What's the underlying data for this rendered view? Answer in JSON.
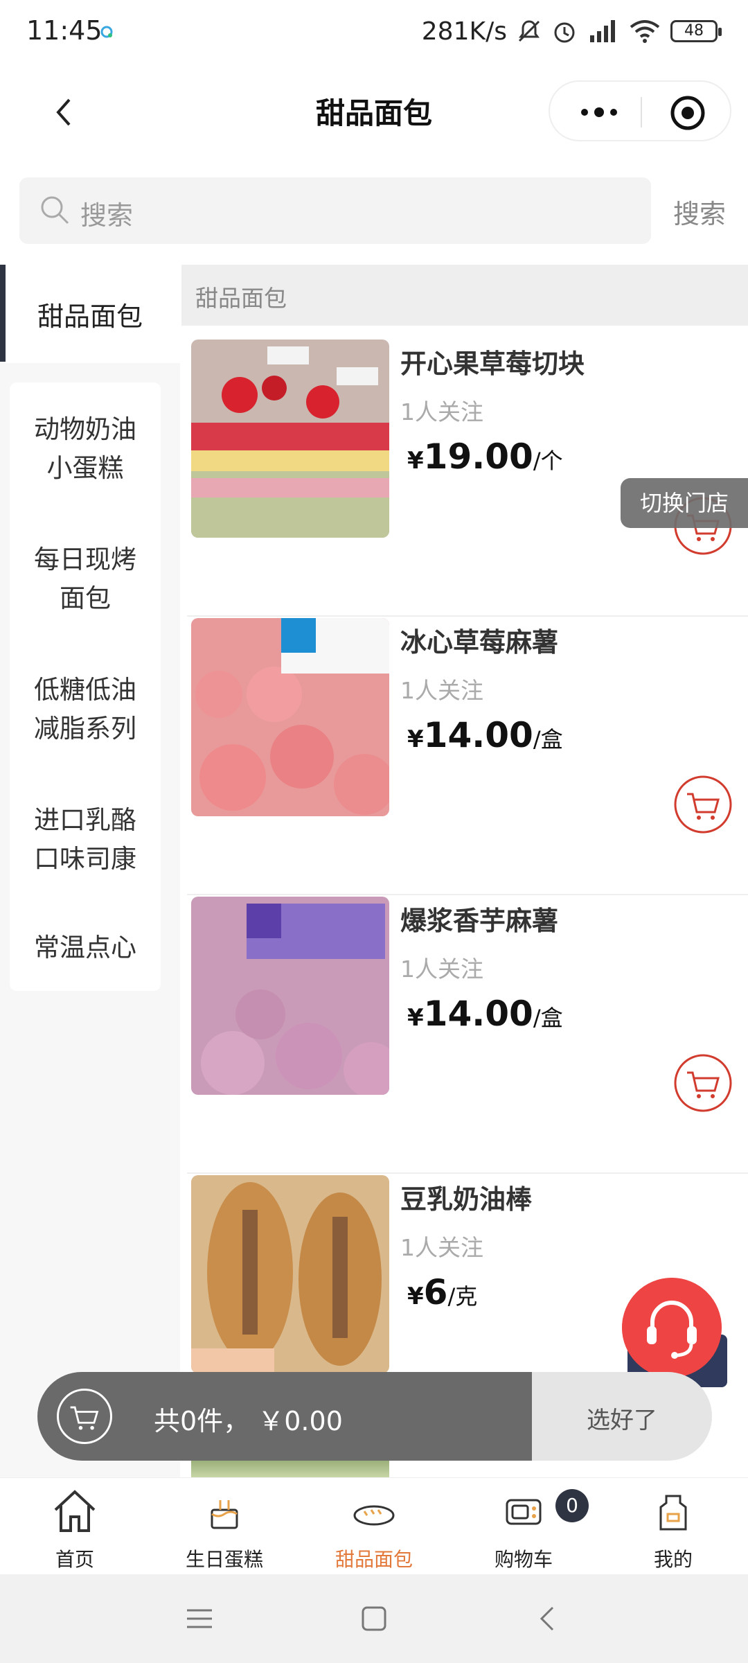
{
  "status_bar": {
    "time": "11:45",
    "net_speed": "281K/s",
    "battery": "48"
  },
  "nav": {
    "title": "甜品面包"
  },
  "search": {
    "placeholder": "搜索",
    "button": "搜索"
  },
  "sidebar": {
    "active": "甜品面包",
    "items": [
      {
        "line1": "动物奶油",
        "line2": "小蛋糕"
      },
      {
        "line1": "每日现烤",
        "line2": "面包"
      },
      {
        "line1": "低糖低油",
        "line2": "减脂系列"
      },
      {
        "line1": "进口乳酪",
        "line2": "口味司康"
      },
      {
        "line1": "常温点心",
        "line2": ""
      }
    ]
  },
  "section": {
    "title": "甜品面包"
  },
  "products": [
    {
      "name": "开心果草莓切块",
      "follow": "1人关注",
      "currency": "¥",
      "price": "19.00",
      "unit": "/个"
    },
    {
      "name": "冰心草莓麻薯",
      "follow": "1人关注",
      "currency": "¥",
      "price": "14.00",
      "unit": "/盒"
    },
    {
      "name": "爆浆香芋麻薯",
      "follow": "1人关注",
      "currency": "¥",
      "price": "14.00",
      "unit": "/盒"
    },
    {
      "name": "豆乳奶油棒",
      "follow": "1人关注",
      "currency": "¥",
      "price": "6",
      "unit": "/克"
    }
  ],
  "floating": {
    "switch_store": "切换门店"
  },
  "cart_bar": {
    "summary": "共0件， ￥0.00",
    "done": "选好了"
  },
  "tabbar": {
    "tabs": [
      {
        "label": "首页",
        "icon": "home-icon"
      },
      {
        "label": "生日蛋糕",
        "icon": "cake-icon"
      },
      {
        "label": "甜品面包",
        "icon": "bread-icon",
        "active": true
      },
      {
        "label": "购物车",
        "icon": "oven-icon"
      },
      {
        "label": "我的",
        "icon": "apron-icon"
      }
    ],
    "cart_badge": "0"
  },
  "colors": {
    "accent": "#e2783a",
    "cart_red": "#d23c2e",
    "dark": "#2f3442"
  }
}
